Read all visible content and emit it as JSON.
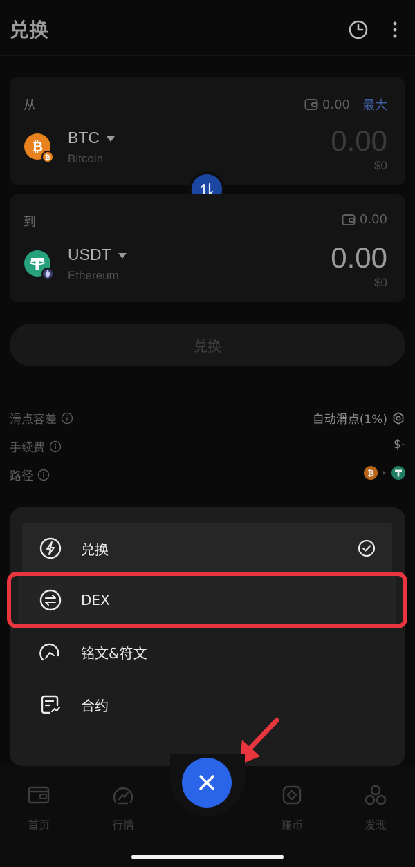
{
  "header": {
    "title": "兑换"
  },
  "from": {
    "label": "从",
    "balance": "0.00",
    "max_label": "最大",
    "symbol": "BTC",
    "network": "Bitcoin",
    "amount": "0.00",
    "usd": "$0"
  },
  "to": {
    "label": "到",
    "balance": "0.00",
    "symbol": "USDT",
    "network": "Ethereum",
    "amount": "0.00",
    "usd": "$0"
  },
  "swap_button": "兑换",
  "info": {
    "slippage_label": "滑点容差",
    "slippage_value": "自动滑点(1%)",
    "fee_label": "手续费",
    "fee_value": "$-",
    "route_label": "路径"
  },
  "menu": {
    "items": [
      {
        "label": "兑换",
        "selected": true
      },
      {
        "label": "DEX",
        "selected": false
      },
      {
        "label": "铭文&符文",
        "selected": false
      },
      {
        "label": "合约",
        "selected": false
      }
    ]
  },
  "tabs": [
    {
      "label": "首页"
    },
    {
      "label": "行情"
    },
    {
      "label": "赚币"
    },
    {
      "label": "发现"
    }
  ],
  "colors": {
    "accent": "#2a64e8",
    "highlight": "#e8353e",
    "btc": "#e8821e",
    "usdt": "#26a17b"
  }
}
